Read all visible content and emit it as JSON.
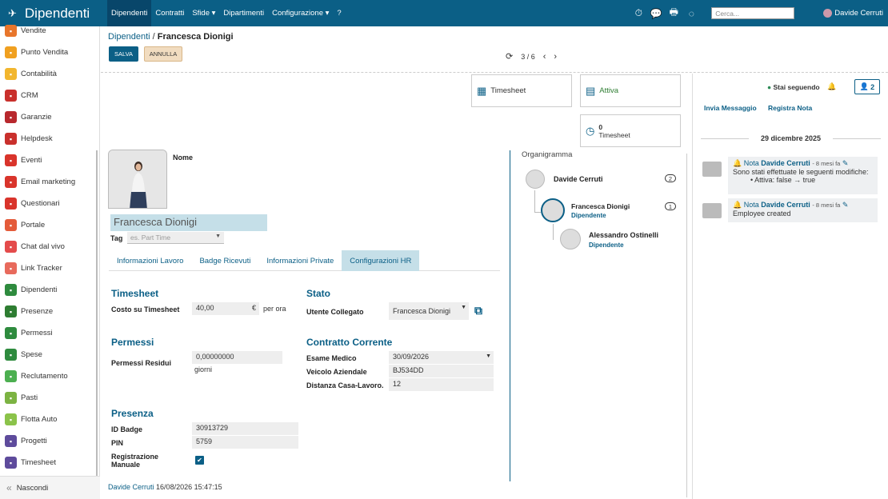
{
  "app": {
    "title": "Dipendenti"
  },
  "nav": {
    "items": [
      "Dipendenti",
      "Contratti",
      "Sfide ▾",
      "Dipartimenti",
      "Configurazione ▾",
      "?"
    ],
    "search_placeholder": "Cerca...",
    "user": "Davide Cerruti"
  },
  "sidebar": {
    "items": [
      {
        "label": "Vendite",
        "color": "#e8762b",
        "icon": "chart-icon"
      },
      {
        "label": "Punto Vendita",
        "color": "#f0a020",
        "icon": "pos-icon"
      },
      {
        "label": "Contabilità",
        "color": "#f2b62e",
        "icon": "accounting-icon"
      },
      {
        "label": "CRM",
        "color": "#c9302c",
        "icon": "crm-icon"
      },
      {
        "label": "Garanzie",
        "color": "#b8282d",
        "icon": "shield-icon"
      },
      {
        "label": "Helpdesk",
        "color": "#c9302c",
        "icon": "headset-icon"
      },
      {
        "label": "Eventi",
        "color": "#d9342b",
        "icon": "ticket-icon"
      },
      {
        "label": "Email marketing",
        "color": "#d9342b",
        "icon": "paper-plane-icon"
      },
      {
        "label": "Questionari",
        "color": "#d9342b",
        "icon": "survey-icon"
      },
      {
        "label": "Portale",
        "color": "#e45b3a",
        "icon": "globe-icon"
      },
      {
        "label": "Chat dal vivo",
        "color": "#e44b4b",
        "icon": "chat-icon"
      },
      {
        "label": "Link Tracker",
        "color": "#e86a5c",
        "icon": "link-icon"
      },
      {
        "label": "Dipendenti",
        "color": "#2e8b3e",
        "icon": "people-icon"
      },
      {
        "label": "Presenze",
        "color": "#2e7d32",
        "icon": "person-icon"
      },
      {
        "label": "Permessi",
        "color": "#2e8b3e",
        "icon": "leave-icon"
      },
      {
        "label": "Spese",
        "color": "#2e8b3e",
        "icon": "dollar-icon"
      },
      {
        "label": "Reclutamento",
        "color": "#4caf50",
        "icon": "recruit-icon"
      },
      {
        "label": "Pasti",
        "color": "#7cb342",
        "icon": "fork-icon"
      },
      {
        "label": "Flotta Auto",
        "color": "#8bc34a",
        "icon": "car-icon"
      },
      {
        "label": "Progetti",
        "color": "#5e4b9c",
        "icon": "puzzle-icon"
      },
      {
        "label": "Timesheet",
        "color": "#5e4b9c",
        "icon": "clock-icon"
      }
    ],
    "hide_label": "Nascondi"
  },
  "breadcrumb": {
    "parent": "Dipendenti",
    "sep": "/",
    "current": "Francesca Dionigi"
  },
  "buttons": {
    "save": "SALVA",
    "cancel": "ANNULLA"
  },
  "pager": {
    "value": "3 / 6"
  },
  "smart": {
    "timesheet": "Timesheet",
    "attiva": "Attiva",
    "ts_count": "0",
    "ts_label": "Timesheet"
  },
  "form": {
    "name_label": "Nome",
    "name_value": "Francesca Dionigi",
    "tag_label": "Tag",
    "tag_placeholder": "es. Part Time",
    "tabs": [
      "Informazioni Lavoro",
      "Badge Ricevuti",
      "Informazioni Private",
      "Configurazioni HR"
    ],
    "timesheet_h": "Timesheet",
    "costo_label": "Costo su Timesheet",
    "costo_value": "40,00",
    "costo_cur": "€",
    "costo_unit": "per ora",
    "permessi_h": "Permessi",
    "permessi_label": "Permessi Residui",
    "permessi_value": "0,00000000",
    "permessi_unit": "giorni",
    "presenza_h": "Presenza",
    "badge_label": "ID Badge",
    "badge_value": "30913729",
    "pin_label": "PIN",
    "pin_value": "5759",
    "reg_label1": "Registrazione",
    "reg_label2": "Manuale",
    "stato_h": "Stato",
    "utente_label": "Utente Collegato",
    "utente_value": "Francesca Dionigi",
    "contratto_h": "Contratto Corrente",
    "esame_label": "Esame Medico",
    "esame_value": "30/09/2026",
    "veicolo_label": "Veicolo Aziendale",
    "veicolo_value": "BJ534DD",
    "distanza_label": "Distanza Casa-Lavoro.",
    "distanza_value": "12",
    "log_user": "Davide Cerruti",
    "log_date": "16/08/2026 15:47:15"
  },
  "org": {
    "title": "Organigramma",
    "manager": "Davide Cerruti",
    "manager_count": "2",
    "self": "Francesca Dionigi",
    "self_job": "Dipendente",
    "self_count": "1",
    "sub": "Alessandro Ostinelli",
    "sub_job": "Dipendente"
  },
  "chatter": {
    "following": "Stai seguendo",
    "followers": "2",
    "send": "Invia Messaggio",
    "note": "Registra Nota",
    "date": "29 dicembre 2025",
    "m1_type": "Nota",
    "m1_author": "Davide Cerruti",
    "m1_time": "- 8 mesi fa",
    "m1_text": "Sono stati effettuate le seguenti modifiche:",
    "m1_change": "Attiva: false → true",
    "m2_type": "Nota",
    "m2_author": "Davide Cerruti",
    "m2_time": "- 8 mesi fa",
    "m2_text": "Employee created"
  }
}
